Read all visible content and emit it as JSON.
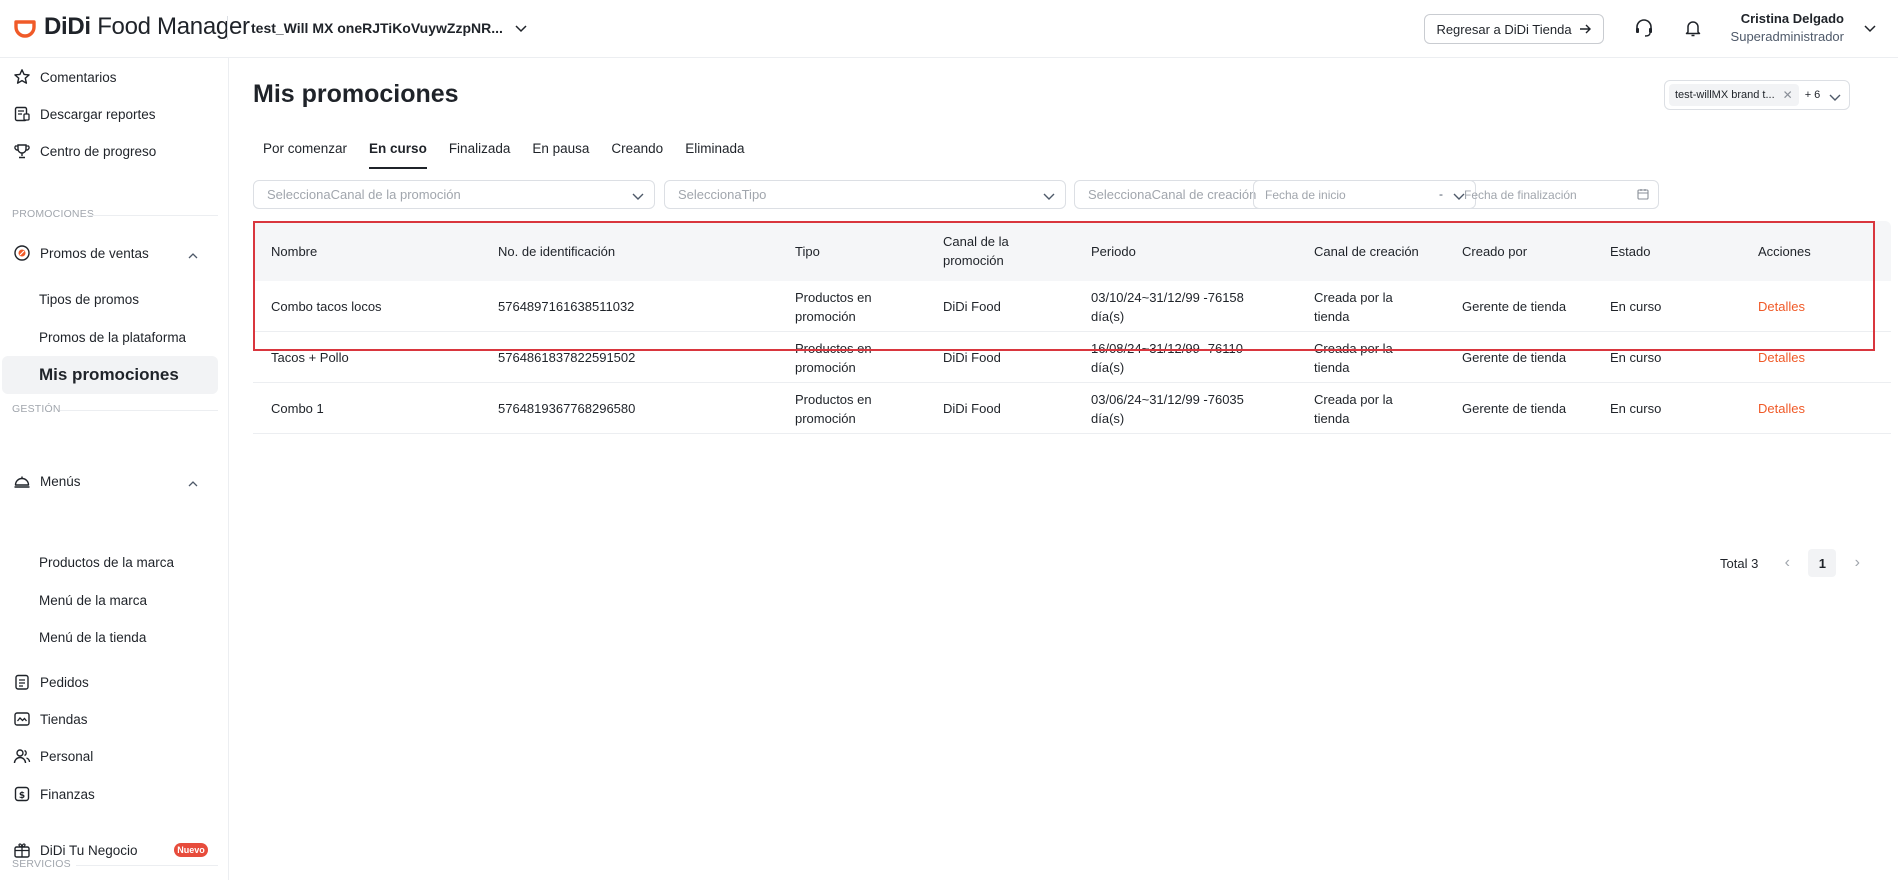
{
  "app": {
    "logo_brand": "DiDi",
    "logo_product": "Food Manager",
    "store_name": "test_Will MX oneRJTiKoVuywZzpNR...",
    "return_button": "Regresar a DiDi Tienda",
    "user_name": "Cristina Delgado",
    "user_role": "Superadministrador"
  },
  "colors": {
    "accent": "#f05a28",
    "highlight": "#d9363e",
    "badge": "#e74c3c"
  },
  "sidebar": {
    "items": [
      {
        "label": "Comentarios",
        "icon": "star-icon"
      },
      {
        "label": "Descargar reportes",
        "icon": "report-icon"
      },
      {
        "label": "Centro de progreso",
        "icon": "trophy-icon"
      }
    ],
    "section_promociones": "PROMOCIONES",
    "promos_group": {
      "label": "Promos de ventas",
      "icon": "promo-icon"
    },
    "promos_sub": [
      "Tipos de promos",
      "Promos de la plataforma",
      "Mis promociones"
    ],
    "section_gestion": "GESTIÓN",
    "menus_group": {
      "label": "Menús",
      "icon": "cloche-icon"
    },
    "menus_sub": [
      "Productos de la marca",
      "Menú de la marca",
      "Menú de la tienda"
    ],
    "gestion_items": [
      {
        "label": "Pedidos",
        "icon": "clipboard-icon"
      },
      {
        "label": "Tiendas",
        "icon": "store-icon"
      },
      {
        "label": "Personal",
        "icon": "people-icon"
      },
      {
        "label": "Finanzas",
        "icon": "dollar-icon"
      }
    ],
    "section_servicios": "SERVICIOS",
    "servicios_item": {
      "label": "DiDi Tu Negocio",
      "icon": "gift-icon",
      "badge": "Nuevo"
    }
  },
  "main": {
    "title": "Mis promociones",
    "brand_filter": {
      "tag": "test-willMX brand t...",
      "more": "+ 6"
    },
    "tabs": [
      "Por comenzar",
      "En curso",
      "Finalizada",
      "En pausa",
      "Creando",
      "Eliminada"
    ],
    "active_tab": "En curso",
    "filters": {
      "channel_placeholder": "SeleccionaCanal de la promoción",
      "type_placeholder": "SeleccionaTipo",
      "creation_placeholder": "SeleccionaCanal de creación",
      "start_placeholder": "Fecha de inicio",
      "date_separator": "-",
      "end_placeholder": "Fecha de finalización"
    },
    "table": {
      "headers": [
        "Nombre",
        "No. de identificación",
        "Tipo",
        "Canal de la promoción",
        "Periodo",
        "Canal de creación",
        "Creado por",
        "Estado",
        "Acciones"
      ],
      "rows": [
        [
          "Combo tacos locos",
          "5764897161638511032",
          "Productos en promoción",
          "DiDi Food",
          "03/10/24~31/12/99 -76158 día(s)",
          "Creada por la tienda",
          "Gerente de tienda",
          "En curso",
          "Detalles"
        ],
        [
          "Tacos + Pollo",
          "5764861837822591502",
          "Productos en promoción",
          "DiDi Food",
          "16/08/24~31/12/99 -76110 día(s)",
          "Creada por la tienda",
          "Gerente de tienda",
          "En curso",
          "Detalles"
        ],
        [
          "Combo 1",
          "5764819367768296580",
          "Productos en promoción",
          "DiDi Food",
          "03/06/24~31/12/99 -76035 día(s)",
          "Creada por la tienda",
          "Gerente de tienda",
          "En curso",
          "Detalles"
        ]
      ]
    },
    "pagination": {
      "total": "Total 3",
      "current_page": "1"
    }
  }
}
